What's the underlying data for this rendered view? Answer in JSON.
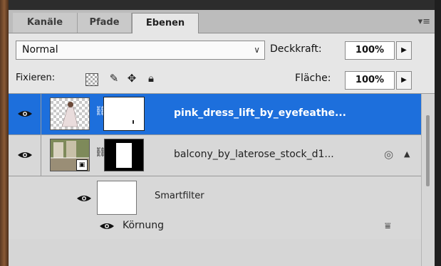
{
  "tabs": [
    {
      "label": "Kanäle"
    },
    {
      "label": "Pfade"
    },
    {
      "label": "Ebenen"
    }
  ],
  "blend": {
    "mode": "Normal"
  },
  "opacity": {
    "label": "Deckkraft:",
    "value": "100%"
  },
  "lock": {
    "label": "Fixieren:"
  },
  "fill": {
    "label": "Fläche:",
    "value": "100%"
  },
  "layers": [
    {
      "name": "pink_dress_lift_by_eyefeathe..."
    },
    {
      "name": "balcony_by_laterose_stock_d1..."
    },
    {
      "name": "Smartfilter"
    },
    {
      "name": "Körnung"
    }
  ],
  "colors": {
    "selection": "#1d6fdc",
    "panel": "#d6d6d6"
  }
}
